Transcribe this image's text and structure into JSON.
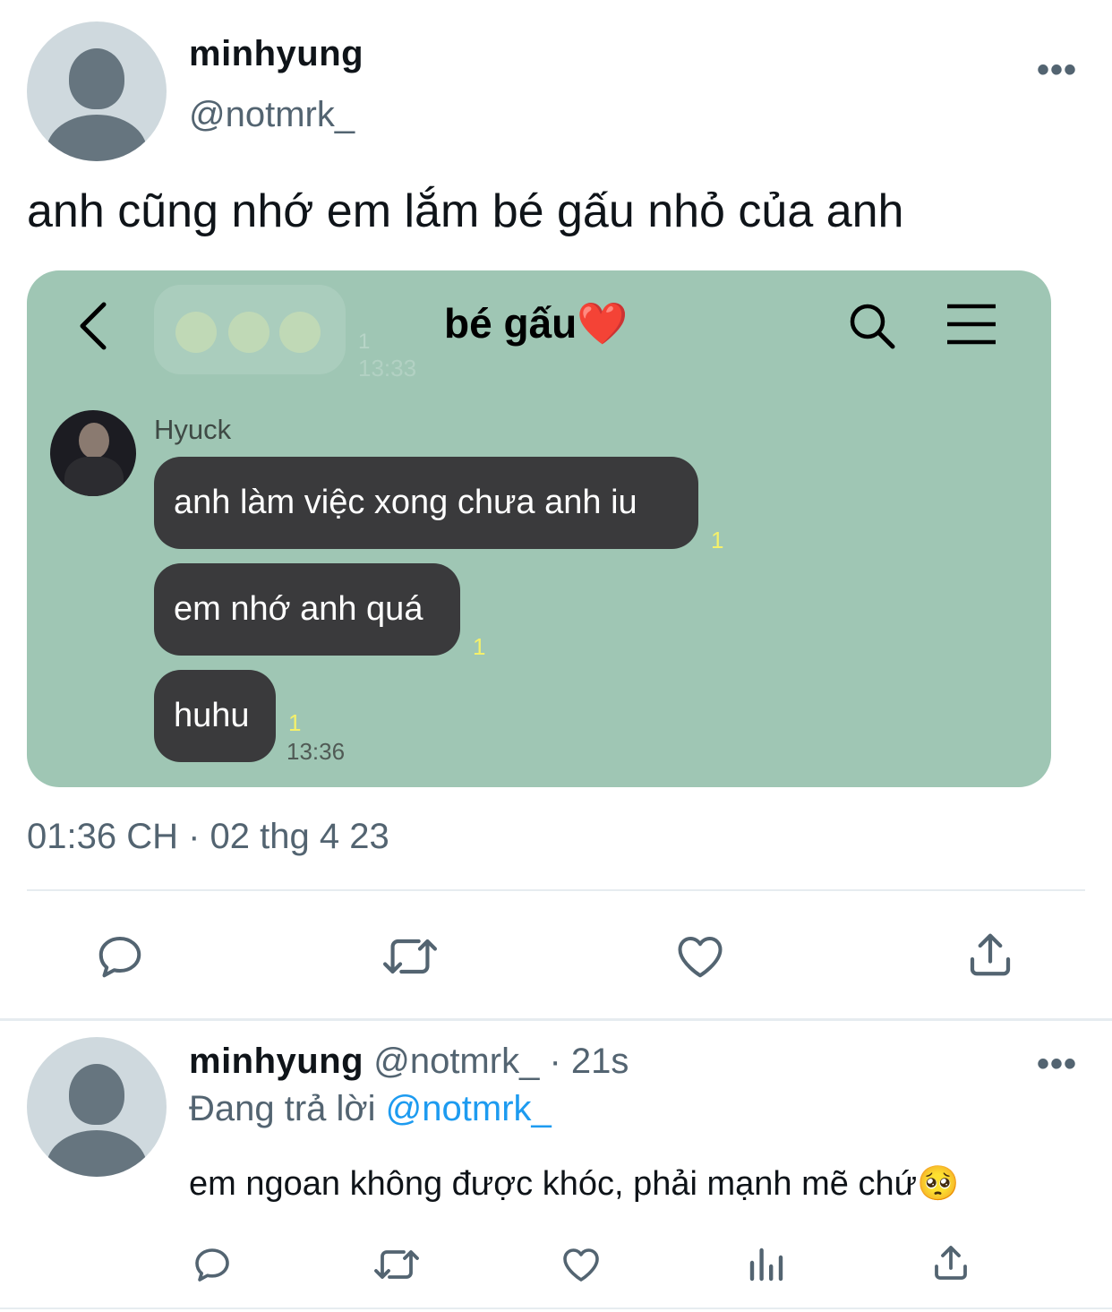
{
  "tweet": {
    "display_name": "minhyung",
    "handle": "@notmrk_",
    "more_label": "•••",
    "text": "anh cũng nhớ em lắm bé gấu nhỏ của anh",
    "timestamp": "01:36 CH · 02 thg 4 23"
  },
  "chat_screenshot": {
    "title": "bé gấu",
    "title_emoji": "❤️",
    "background_color": "#9fc6b4",
    "ghost_unread": "1",
    "ghost_time": "13:33",
    "sender_name": "Hyuck",
    "messages": [
      {
        "text": "anh làm việc xong chưa anh iu",
        "unread": "1"
      },
      {
        "text": "em nhớ anh quá",
        "unread": "1"
      },
      {
        "text": "huhu",
        "unread": "1",
        "time": "13:36"
      }
    ]
  },
  "actions": [
    "reply-icon",
    "retweet-icon",
    "like-icon",
    "share-icon"
  ],
  "reply": {
    "display_name": "minhyung",
    "handle": "@notmrk_",
    "separator": "·",
    "time_ago": "21s",
    "replying_prefix": "Đang trả lời",
    "replying_to": "@notmrk_",
    "text": "em ngoan không được khóc, phải mạnh mẽ chứ",
    "emoji": "🥺",
    "more_label": "•••",
    "actions": [
      "reply-icon",
      "retweet-icon",
      "like-icon",
      "analytics-icon",
      "share-icon"
    ]
  },
  "colors": {
    "accent": "#1d9bf0",
    "muted": "#536471",
    "bubble": "#3a3a3c",
    "unread": "#f4f06a"
  }
}
